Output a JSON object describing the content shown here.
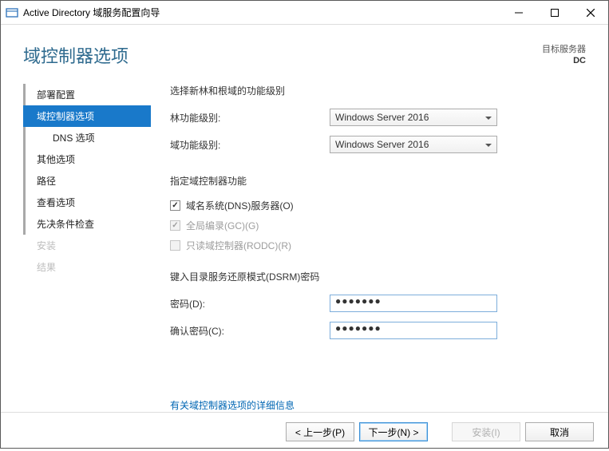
{
  "window": {
    "title": "Active Directory 域服务配置向导"
  },
  "header": {
    "page_title": "域控制器选项",
    "target_label": "目标服务器",
    "target_name": "DC"
  },
  "sidebar": {
    "items": [
      {
        "label": "部署配置"
      },
      {
        "label": "域控制器选项"
      },
      {
        "label": "DNS 选项"
      },
      {
        "label": "其他选项"
      },
      {
        "label": "路径"
      },
      {
        "label": "查看选项"
      },
      {
        "label": "先决条件检查"
      },
      {
        "label": "安装"
      },
      {
        "label": "结果"
      }
    ]
  },
  "main": {
    "level_heading": "选择新林和根域的功能级别",
    "forest_level_label": "林功能级别:",
    "forest_level_value": "Windows Server 2016",
    "domain_level_label": "域功能级别:",
    "domain_level_value": "Windows Server 2016",
    "capabilities_heading": "指定域控制器功能",
    "cb_dns_label": "域名系统(DNS)服务器(O)",
    "cb_gc_label": "全局编录(GC)(G)",
    "cb_rodc_label": "只读域控制器(RODC)(R)",
    "dsrm_heading": "键入目录服务还原模式(DSRM)密码",
    "pwd_label": "密码(D):",
    "pwd_value": "●●●●●●●",
    "pwd_confirm_label": "确认密码(C):",
    "pwd_confirm_value": "●●●●●●●",
    "more_link": "有关域控制器选项的详细信息"
  },
  "footer": {
    "prev": "< 上一步(P)",
    "next": "下一步(N) >",
    "install": "安装(I)",
    "cancel": "取消"
  }
}
